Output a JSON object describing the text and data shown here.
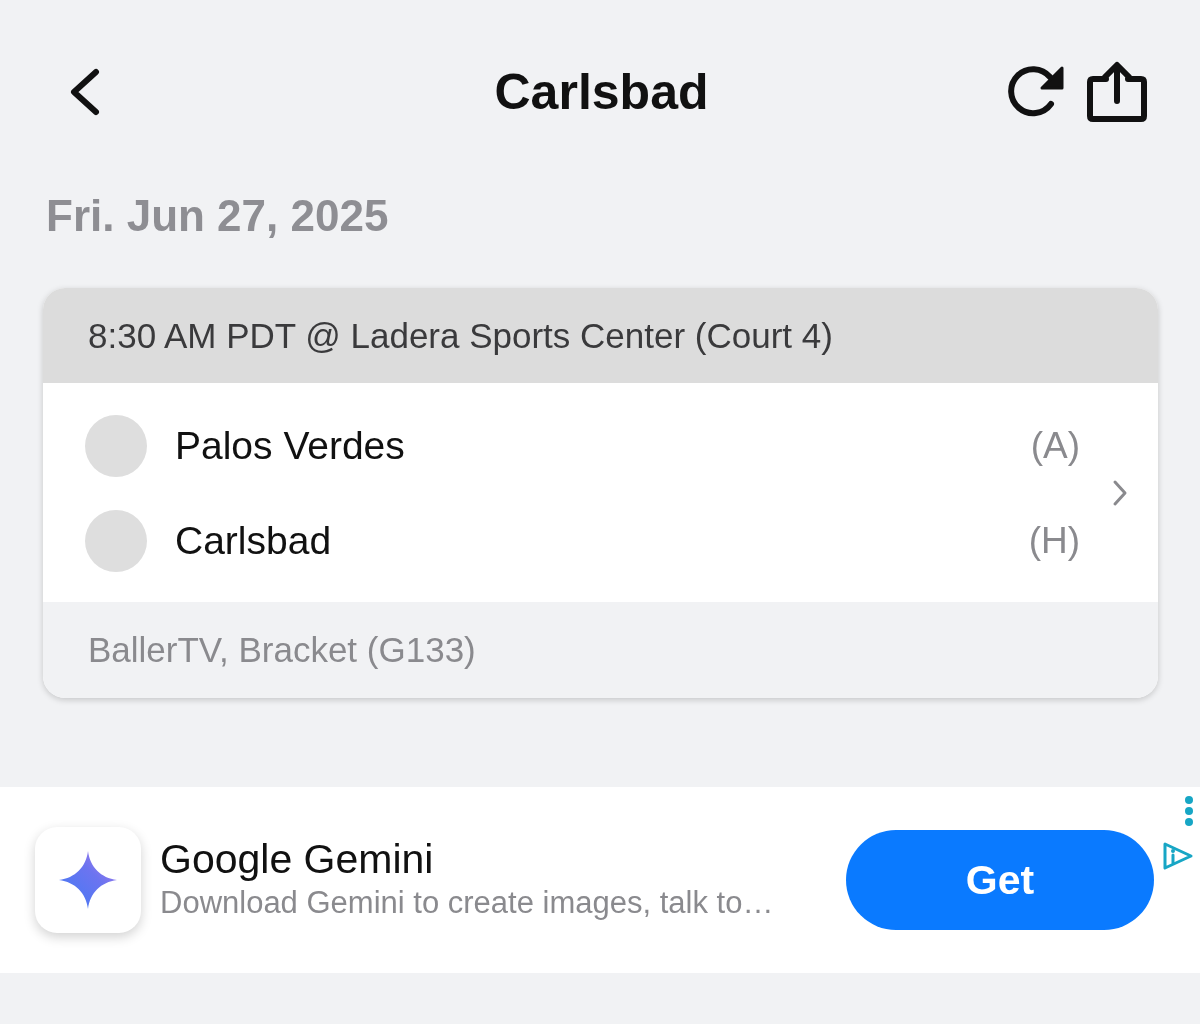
{
  "header": {
    "title": "Carlsbad"
  },
  "date": "Fri. Jun 27, 2025",
  "game": {
    "time_location": "8:30 AM PDT @ Ladera Sports Center (Court 4)",
    "teams": [
      {
        "name": "Palos Verdes",
        "side": "(A)"
      },
      {
        "name": "Carlsbad",
        "side": "(H)"
      }
    ],
    "footer": "BallerTV, Bracket (G133)"
  },
  "ad": {
    "app_name": "Google Gemini",
    "description": "Download Gemini to create images, talk to…",
    "button": "Get"
  }
}
